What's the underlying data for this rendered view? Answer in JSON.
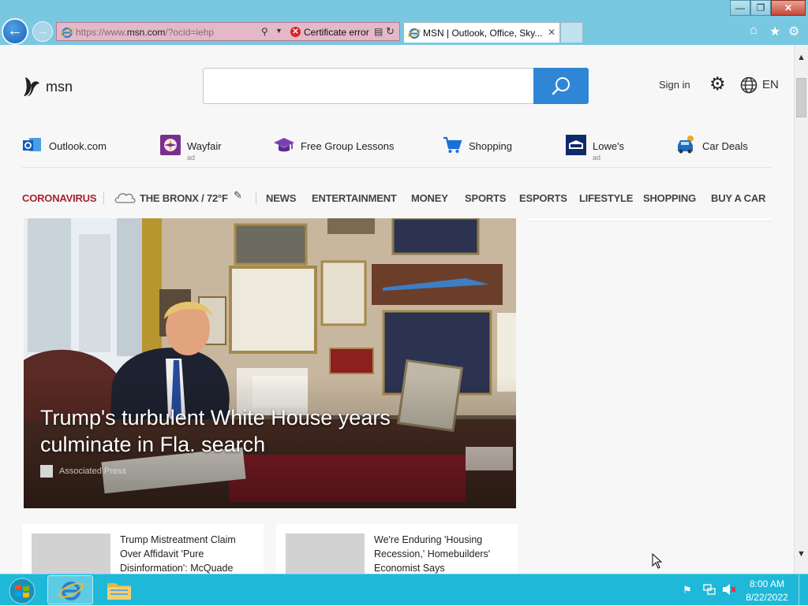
{
  "window": {
    "minimize_glyph": "—",
    "maximize_glyph": "❐",
    "close_glyph": "✕"
  },
  "browser": {
    "back_glyph": "←",
    "forward_glyph": "→",
    "address": {
      "scheme": "https://www.",
      "host": "msn.com",
      "path": "/?ocid=iehp",
      "certificate_error": "Certificate error"
    },
    "tab": {
      "title": "MSN | Outlook, Office, Sky...",
      "close_glyph": "✕"
    },
    "icons": [
      "home-icon",
      "favorites-icon",
      "tools-icon"
    ]
  },
  "page": {
    "logo_text": "msn",
    "search": {
      "placeholder": "",
      "value": ""
    },
    "header": {
      "signin": "Sign in",
      "language": "EN"
    },
    "quicklinks": [
      {
        "label": "Outlook.com",
        "ad": ""
      },
      {
        "label": "Wayfair",
        "ad": "ad"
      },
      {
        "label": "Free Group Lessons",
        "ad": ""
      },
      {
        "label": "Shopping",
        "ad": ""
      },
      {
        "label": "Lowe's",
        "ad": "ad"
      },
      {
        "label": "Car Deals",
        "ad": ""
      }
    ],
    "navbar": {
      "coronavirus": "CORONAVIRUS",
      "weather": "THE BRONX / 72°F",
      "items": [
        "NEWS",
        "ENTERTAINMENT",
        "MONEY",
        "SPORTS",
        "ESPORTS",
        "LIFESTYLE",
        "SHOPPING",
        "BUY A CAR"
      ]
    },
    "hero": {
      "headline": "Trump's turbulent White House years culminate in Fla. search",
      "source": "Associated Press"
    },
    "cards": [
      {
        "title": "Trump Mistreatment Claim Over Affidavit 'Pure Disinformation': McQuade"
      },
      {
        "title": "We're Enduring 'Housing Recession,' Homebuilders' Economist Says"
      }
    ]
  },
  "taskbar": {
    "time": "8:00 AM",
    "date": "8/22/2022"
  },
  "colors": {
    "chrome": "#79c8e2",
    "address_error": "#e3b8c9",
    "search_button": "#2f86d6",
    "coronavirus_red": "#a8242c",
    "taskbar": "#1fb8d8"
  }
}
